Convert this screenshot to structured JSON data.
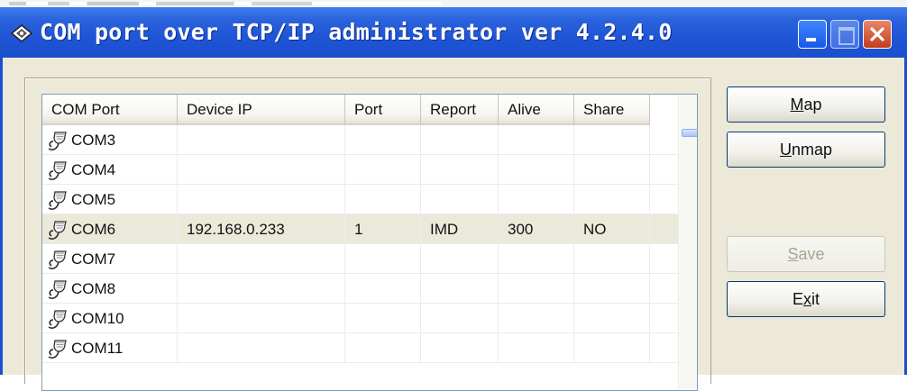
{
  "window": {
    "title": "COM port over TCP/IP administrator ver 4.2.4.0"
  },
  "columns": [
    "COM Port",
    "Device IP",
    "Port",
    "Report",
    "Alive",
    "Share"
  ],
  "rows": [
    {
      "com": "COM3",
      "ip": "",
      "port": "",
      "report": "",
      "alive": "",
      "share": ""
    },
    {
      "com": "COM4",
      "ip": "",
      "port": "",
      "report": "",
      "alive": "",
      "share": ""
    },
    {
      "com": "COM5",
      "ip": "",
      "port": "",
      "report": "",
      "alive": "",
      "share": ""
    },
    {
      "com": "COM6",
      "ip": "192.168.0.233",
      "port": "1",
      "report": "IMD",
      "alive": "300",
      "share": "NO"
    },
    {
      "com": "COM7",
      "ip": "",
      "port": "",
      "report": "",
      "alive": "",
      "share": ""
    },
    {
      "com": "COM8",
      "ip": "",
      "port": "",
      "report": "",
      "alive": "",
      "share": ""
    },
    {
      "com": "COM10",
      "ip": "",
      "port": "",
      "report": "",
      "alive": "",
      "share": ""
    },
    {
      "com": "COM11",
      "ip": "",
      "port": "",
      "report": "",
      "alive": "",
      "share": ""
    }
  ],
  "buttons": {
    "map": {
      "mnemonic": "M",
      "rest": "ap"
    },
    "unmap": {
      "mnemonic": "U",
      "rest": "nmap"
    },
    "save": {
      "mnemonic": "S",
      "rest": "ave"
    },
    "exit": {
      "pre": "E",
      "mnemonic": "x",
      "rest": "it"
    }
  },
  "colors": {
    "titlebar": "#1f55d6",
    "selected_row": "#ebe9d9",
    "face": "#ece9d8"
  },
  "icons": {
    "app": "network-port-icon",
    "row": "serial-port-icon"
  }
}
